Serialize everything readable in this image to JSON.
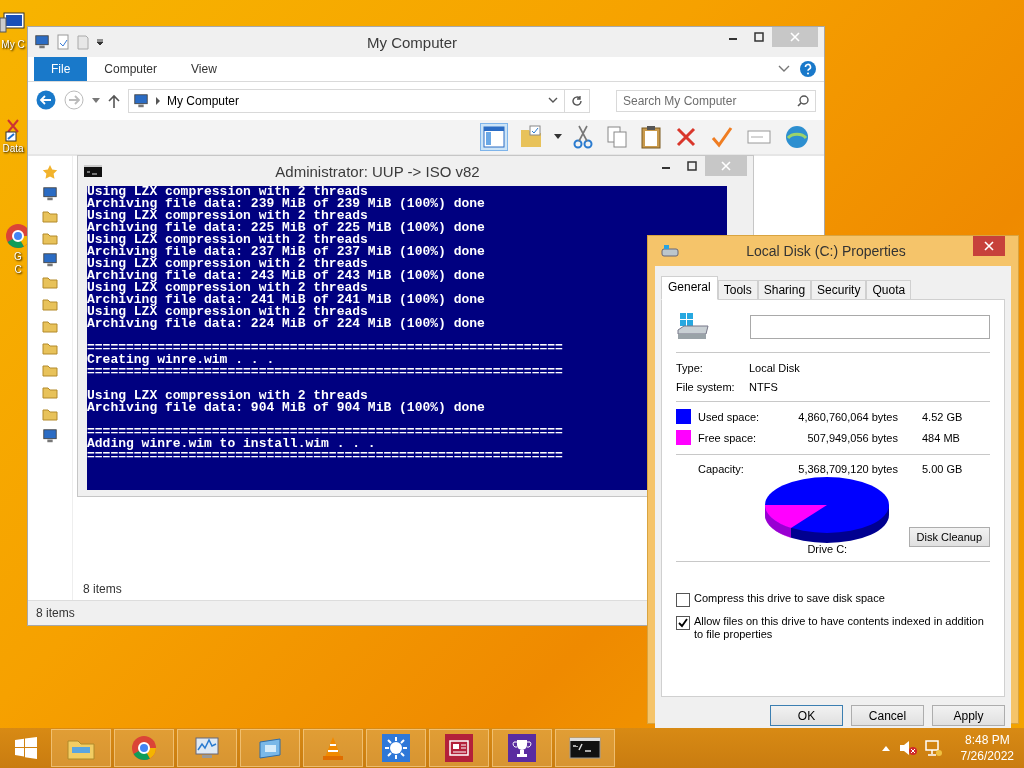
{
  "desktop_icons": [
    {
      "kind": "computer",
      "lines": [
        "My C"
      ]
    },
    {
      "kind": "disk",
      "lines": [
        "Data"
      ]
    },
    {
      "kind": "chrome",
      "lines": [
        "G",
        "C"
      ]
    }
  ],
  "explorer": {
    "title": "My Computer",
    "ribbon_tabs": [
      {
        "kind": "file",
        "label": "File"
      },
      {
        "kind": "tab",
        "label": "Computer"
      },
      {
        "kind": "tab",
        "label": "View"
      }
    ],
    "address": "My Computer",
    "search": {
      "placeholder": "Search My Computer"
    },
    "content_status": "8 items",
    "status_bar": "8 items"
  },
  "console": {
    "title": "Administrator:  UUP -> ISO v82",
    "lines": [
      {
        "kind": "text",
        "text": "Using LZX compression with 2 threads"
      },
      {
        "kind": "text",
        "text": "Archiving file data: 239 MiB of 239 MiB (100%) done"
      },
      {
        "kind": "text",
        "text": "Using LZX compression with 2 threads"
      },
      {
        "kind": "text",
        "text": "Archiving file data: 225 MiB of 225 MiB (100%) done"
      },
      {
        "kind": "text",
        "text": "Using LZX compression with 2 threads"
      },
      {
        "kind": "text",
        "text": "Archiving file data: 237 MiB of 237 MiB (100%) done"
      },
      {
        "kind": "text",
        "text": "Using LZX compression with 2 threads"
      },
      {
        "kind": "text",
        "text": "Archiving file data: 243 MiB of 243 MiB (100%) done"
      },
      {
        "kind": "text",
        "text": "Using LZX compression with 2 threads"
      },
      {
        "kind": "text",
        "text": "Archiving file data: 241 MiB of 241 MiB (100%) done"
      },
      {
        "kind": "text",
        "text": "Using LZX compression with 2 threads"
      },
      {
        "kind": "text",
        "text": "Archiving file data: 224 MiB of 224 MiB (100%) done"
      },
      {
        "kind": "gap"
      },
      {
        "kind": "text",
        "text": "============================================================="
      },
      {
        "kind": "text",
        "text": "Creating winre.wim . . ."
      },
      {
        "kind": "text",
        "text": "============================================================="
      },
      {
        "kind": "gap"
      },
      {
        "kind": "text",
        "text": "Using LZX compression with 2 threads"
      },
      {
        "kind": "text",
        "text": "Archiving file data: 904 MiB of 904 MiB (100%) done"
      },
      {
        "kind": "gap"
      },
      {
        "kind": "text",
        "text": "============================================================="
      },
      {
        "kind": "text",
        "text": "Adding winre.wim to install.wim . . ."
      },
      {
        "kind": "text",
        "text": "============================================================="
      }
    ]
  },
  "properties": {
    "title": "Local Disk (C:) Properties",
    "tabs": [
      {
        "label": "General",
        "selected": true
      },
      {
        "label": "Tools",
        "selected": false
      },
      {
        "label": "Sharing",
        "selected": false
      },
      {
        "label": "Security",
        "selected": false
      },
      {
        "label": "Quota",
        "selected": false
      }
    ],
    "info": [
      {
        "label": "Type:",
        "value": "Local Disk"
      },
      {
        "label": "File system:",
        "value": "NTFS"
      }
    ],
    "space": [
      {
        "label": "Used space:",
        "bytes": "4,860,760,064 bytes",
        "size": "4.52 GB",
        "color": "#0000ff"
      },
      {
        "label": "Free space:",
        "bytes": "507,949,056 bytes",
        "size": "484 MB",
        "color": "#ff00ff"
      }
    ],
    "capacity": {
      "label": "Capacity:",
      "bytes": "5,368,709,120 bytes",
      "size": "5.00 GB"
    },
    "drive_label": "Drive C:",
    "cleanup_button": "Disk Cleanup",
    "options": [
      {
        "label": "Compress this drive to save disk space",
        "checked": false
      },
      {
        "label": "Allow files on this drive to have contents indexed in addition to file properties",
        "checked": true
      }
    ],
    "buttons": [
      "OK",
      "Cancel",
      "Apply"
    ]
  },
  "taskbar": {
    "apps": [
      {
        "kind": "explorer"
      },
      {
        "kind": "chrome"
      },
      {
        "kind": "monitor"
      },
      {
        "kind": "remote"
      },
      {
        "kind": "vlc"
      },
      {
        "kind": "weather"
      },
      {
        "kind": "news"
      },
      {
        "kind": "trophy"
      },
      {
        "kind": "console"
      }
    ],
    "time": "8:48 PM",
    "date": "7/26/2022"
  }
}
